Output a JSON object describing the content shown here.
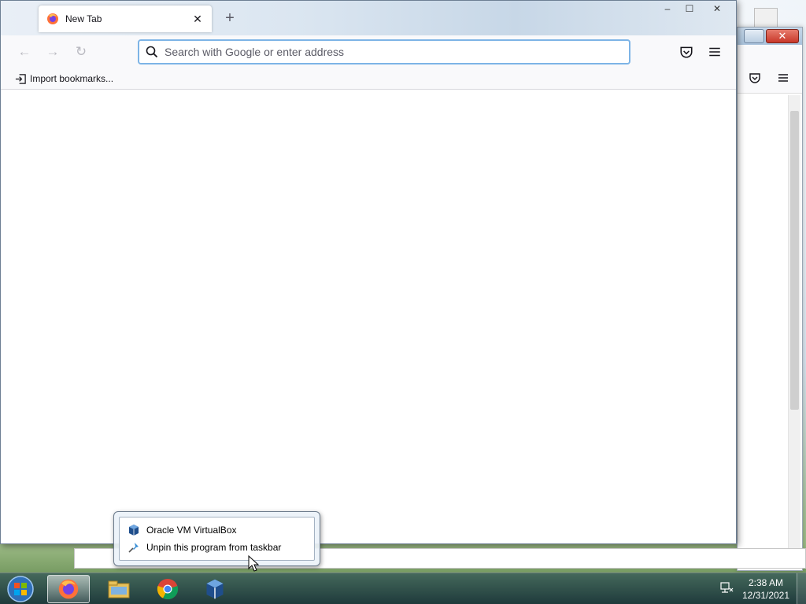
{
  "firefox": {
    "tab_title": "New Tab",
    "tab_close": "✕",
    "new_tab": "+",
    "url_placeholder": "Search with Google or enter address",
    "nav": {
      "back": "←",
      "forward": "→",
      "reload": "↻"
    },
    "bookmarks": {
      "import_label": "Import bookmarks..."
    },
    "window_controls": {
      "minimize": "–",
      "maximize": "☐",
      "close": "✕"
    }
  },
  "background_window": {
    "close": "✕"
  },
  "jumplist": {
    "items": [
      {
        "label": "Oracle VM VirtualBox",
        "icon": "virtualbox-icon"
      },
      {
        "label": "Unpin this program from taskbar",
        "icon": "unpin-icon"
      }
    ]
  },
  "taskbar": {
    "items": [
      "start-orb",
      "firefox-icon",
      "file-explorer-icon",
      "chrome-icon",
      "virtualbox-icon"
    ],
    "clock": {
      "time": "2:38 AM",
      "date": "12/31/2021"
    }
  },
  "colors": {
    "urlbar_focus": "#7db4e6",
    "taskbar": "#2a4a4e",
    "firefox_orange": "#ff7139"
  }
}
